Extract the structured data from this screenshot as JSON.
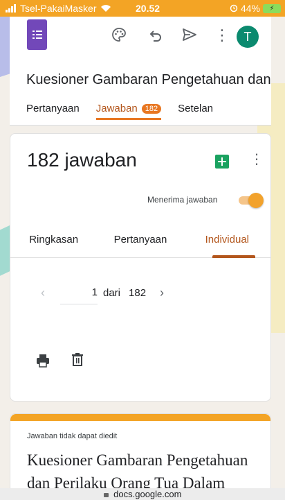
{
  "status_bar": {
    "carrier": "Tsel-PakaiMasker",
    "time": "20.52",
    "battery_percent": "44%"
  },
  "toolbar": {
    "avatar_initial": "T",
    "icons": [
      "google-forms-logo",
      "palette-icon",
      "undo-icon",
      "send-icon",
      "more-vert-icon"
    ]
  },
  "form": {
    "title": "Kuesioner Gambaran Pengetahuan dan I",
    "tabs": [
      {
        "label": "Pertanyaan"
      },
      {
        "label": "Jawaban",
        "badge": "182"
      },
      {
        "label": "Setelan"
      }
    ]
  },
  "responses": {
    "count_label": "182 jawaban",
    "accepting_label": "Menerima jawaban",
    "accepting": true,
    "subtabs": [
      {
        "label": "Ringkasan"
      },
      {
        "label": "Pertanyaan"
      },
      {
        "label": "Individual"
      }
    ],
    "pager": {
      "current": "1",
      "of_label": "dari",
      "total": "182"
    }
  },
  "form_card": {
    "note": "Jawaban tidak dapat diedit",
    "heading": "Kuesioner Gambaran Pengetahuan dan Perilaku Orang Tua Dalam Membarikan Pendidikan Seksual"
  },
  "url_bar": {
    "domain": "docs.google.com"
  },
  "colors": {
    "accent": "#e87722",
    "accent_text": "#b3561c",
    "status_bar": "#f3a425",
    "avatar": "#0b8a6f",
    "forms_purple": "#7248b9",
    "sheets_green": "#1aa260"
  }
}
